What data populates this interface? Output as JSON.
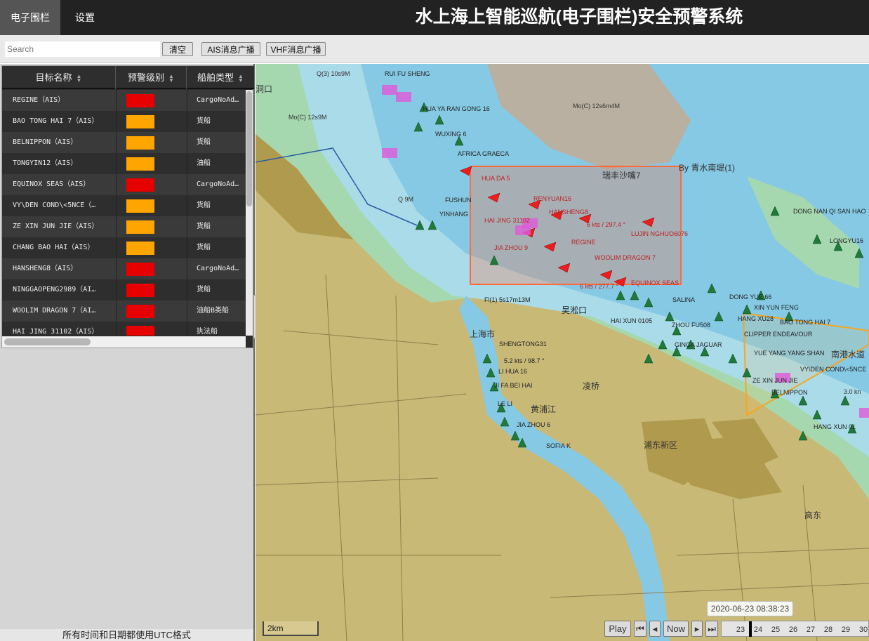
{
  "app": {
    "tabs": [
      "电子围栏",
      "设置"
    ],
    "title": "水上海上智能巡航(电子围栏)安全预警系统"
  },
  "toolbar": {
    "search_placeholder": "Search",
    "clear": "清空",
    "ais": "AIS消息广播",
    "vhf": "VHF消息广播"
  },
  "table": {
    "columns": [
      "目标名称",
      "预警级别",
      "船舶类型"
    ],
    "rows": [
      {
        "name": "REGINE（AIS）",
        "level": "#e60000",
        "type": "CargoNoAd…"
      },
      {
        "name": "BAO TONG HAI 7（AIS）",
        "level": "#ffa500",
        "type": "货船"
      },
      {
        "name": "BELNIPPON（AIS）",
        "level": "#ffa500",
        "type": "货船"
      },
      {
        "name": "TONGYIN12（AIS）",
        "level": "#ffa500",
        "type": "油船"
      },
      {
        "name": "EQUINOX SEAS（AIS）",
        "level": "#e60000",
        "type": "CargoNoAd…"
      },
      {
        "name": "VY\\DEN COND\\<5NCE（…",
        "level": "#ffa500",
        "type": "货船"
      },
      {
        "name": "ZE XIN JUN JIE（AIS）",
        "level": "#ffa500",
        "type": "货船"
      },
      {
        "name": "CHANG BAO HAI（AIS）",
        "level": "#ffa500",
        "type": "货船"
      },
      {
        "name": "HANSHENG8（AIS）",
        "level": "#e60000",
        "type": "CargoNoAd…"
      },
      {
        "name": "NINGGAOPENG2989（AI…",
        "level": "#e60000",
        "type": "货船"
      },
      {
        "name": "WOOLIM DRAGON 7（AI…",
        "level": "#e60000",
        "type": "油船B类船"
      },
      {
        "name": "HAI JING 31102（AIS）",
        "level": "#e60000",
        "type": "执法船"
      }
    ]
  },
  "footer_note": "所有时间和日期都使用UTC格式",
  "map": {
    "scale": "2km",
    "fence_color": "#ff6a3d",
    "labels": [
      {
        "t": "RUI FU SHENG",
        "c": "#222"
      },
      {
        "t": "HUA YA RAN GONG 16",
        "c": "#222"
      },
      {
        "t": "WUXING 6",
        "c": "#222"
      },
      {
        "t": "AFRICA GRAECA",
        "c": "#222"
      },
      {
        "t": "HUA DA 5",
        "c": "#b22"
      },
      {
        "t": "瑞丰沙嘴7",
        "c": "#333"
      },
      {
        "t": "RENYUAN16",
        "c": "#b22"
      },
      {
        "t": "HANSHENG8",
        "c": "#b22"
      },
      {
        "t": "FUSHUN",
        "c": "#222"
      },
      {
        "t": "YINHANG",
        "c": "#222"
      },
      {
        "t": "HAI JING 31102",
        "c": "#b22"
      },
      {
        "t": "6 kts / 297.4 °",
        "c": "#b22"
      },
      {
        "t": "LUJIN NGHUO6076",
        "c": "#b22"
      },
      {
        "t": "REGINE",
        "c": "#b22"
      },
      {
        "t": "JIA ZHOU 9",
        "c": "#b22"
      },
      {
        "t": "WOOLIM DRAGON 7",
        "c": "#b22"
      },
      {
        "t": "6 kts / 277.7 °",
        "c": "#b22"
      },
      {
        "t": "EQUINOX SEAS",
        "c": "#b22"
      },
      {
        "t": "Fl(1) 5s17m13M",
        "c": "#222"
      },
      {
        "t": "吴淞口",
        "c": "#222"
      },
      {
        "t": "SALINA",
        "c": "#222"
      },
      {
        "t": "DONG YUE 66",
        "c": "#222"
      },
      {
        "t": "XIN YUN FENG",
        "c": "#222"
      },
      {
        "t": "HAI XUN 0105",
        "c": "#222"
      },
      {
        "t": "ZHOU FU508",
        "c": "#222"
      },
      {
        "t": "HANG XU28",
        "c": "#222"
      },
      {
        "t": "BAO TONG HAI 7",
        "c": "#222"
      },
      {
        "t": "CLIPPER ENDEAVOUR",
        "c": "#222"
      },
      {
        "t": "GINGA JAGUAR",
        "c": "#222"
      },
      {
        "t": "YUE YANG YANG SHAN",
        "c": "#222"
      },
      {
        "t": "SHENGTONG31",
        "c": "#222"
      },
      {
        "t": "5.2 kts / 98.7 °",
        "c": "#222"
      },
      {
        "t": "LI HUA 16",
        "c": "#222"
      },
      {
        "t": "JI FA BEI HAI",
        "c": "#222"
      },
      {
        "t": "LE LI",
        "c": "#222"
      },
      {
        "t": "JIA ZHOU 6",
        "c": "#222"
      },
      {
        "t": "SOFIA K",
        "c": "#222"
      },
      {
        "t": "ZE XIN JUN JIE",
        "c": "#222"
      },
      {
        "t": "VY\\DEN COND\\<5NCE",
        "c": "#222"
      },
      {
        "t": "BELNIPPON",
        "c": "#222"
      },
      {
        "t": "HANG XUN 01",
        "c": "#222"
      },
      {
        "t": "DONG NAN QI SAN HAO",
        "c": "#222"
      },
      {
        "t": "LONGYU16",
        "c": "#222"
      },
      {
        "t": "Mo(C) 12s6m4M",
        "c": "#333"
      },
      {
        "t": "Mo(C) 12s9M",
        "c": "#333"
      },
      {
        "t": "Q(3) 10s9M",
        "c": "#333"
      },
      {
        "t": "Q 9M",
        "c": "#333"
      },
      {
        "t": "By 青水南堤(1)",
        "c": "#333"
      },
      {
        "t": "上海市",
        "c": "#333"
      },
      {
        "t": "黄浦江",
        "c": "#333"
      },
      {
        "t": "凌桥",
        "c": "#333"
      },
      {
        "t": "浦东新区",
        "c": "#333"
      },
      {
        "t": "南港水道",
        "c": "#333"
      },
      {
        "t": "高东",
        "c": "#333"
      },
      {
        "t": "3.0 kn",
        "c": "#333"
      },
      {
        "t": "洞口",
        "c": "#333"
      }
    ]
  },
  "player": {
    "play": "Play",
    "now": "Now",
    "first": "⏮",
    "prev": "◂",
    "next": "▸",
    "last": "⏭",
    "ticks": [
      "23",
      "24",
      "25",
      "26",
      "27",
      "28",
      "29",
      "30"
    ],
    "tooltip": "2020-06-23 08:38:23"
  }
}
